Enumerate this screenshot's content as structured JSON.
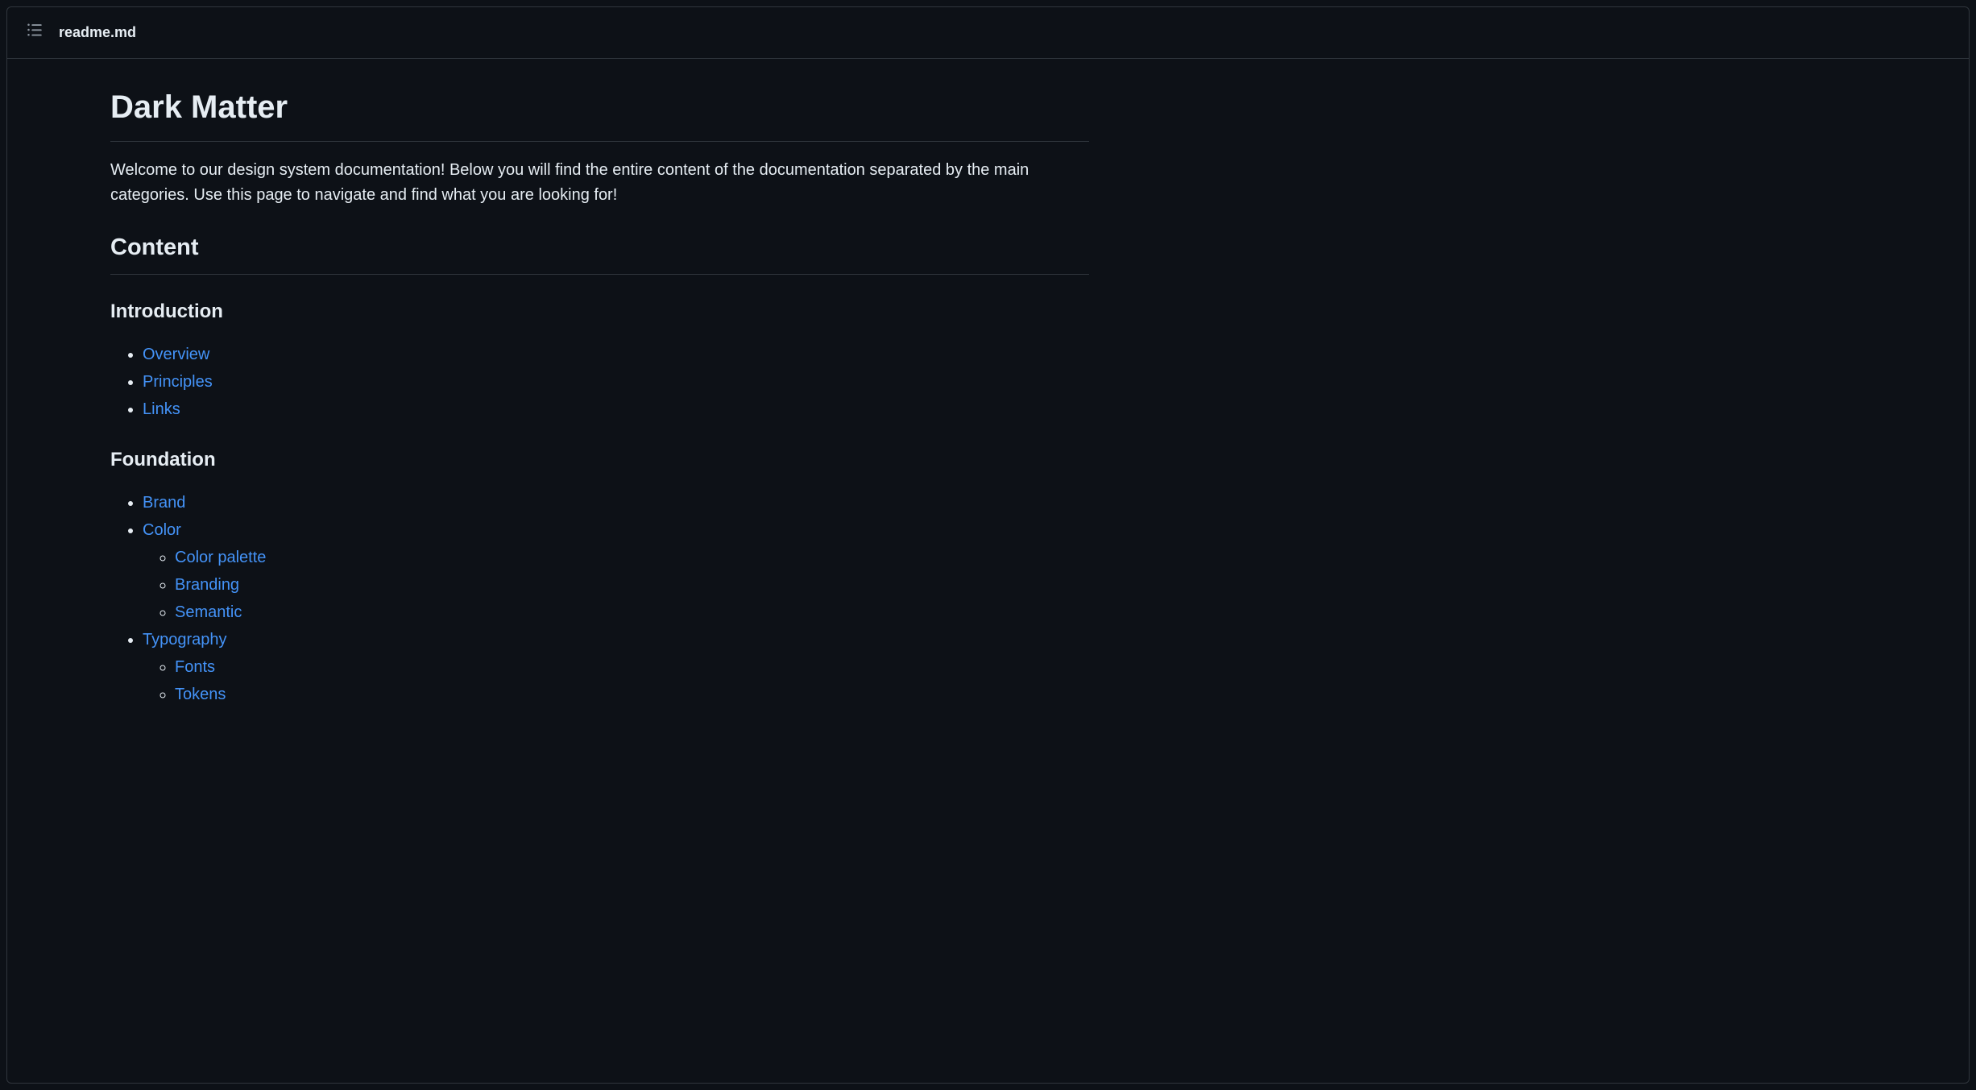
{
  "header": {
    "filename": "readme.md"
  },
  "document": {
    "title": "Dark Matter",
    "intro": "Welcome to our design system documentation! Below you will find the entire content of the documentation separated by the main categories. Use this page to navigate and find what you are looking for!",
    "content_heading": "Content",
    "sections": {
      "introduction": {
        "heading": "Introduction",
        "links": {
          "overview": "Overview",
          "principles": "Principles",
          "links": "Links"
        }
      },
      "foundation": {
        "heading": "Foundation",
        "links": {
          "brand": "Brand",
          "color": "Color",
          "color_sub": {
            "palette": "Color palette",
            "branding": "Branding",
            "semantic": "Semantic"
          },
          "typography": "Typography",
          "typography_sub": {
            "fonts": "Fonts",
            "tokens": "Tokens"
          }
        }
      }
    }
  }
}
